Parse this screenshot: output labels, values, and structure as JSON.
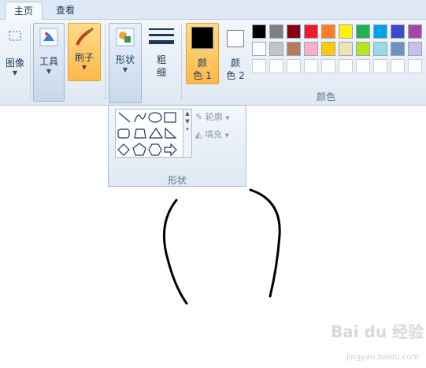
{
  "tabs": [
    {
      "label": "主页",
      "active": true
    },
    {
      "label": "查看",
      "active": false
    }
  ],
  "toolbar": {
    "image": "图像",
    "tools": "工具",
    "brush": "刷子",
    "shapes": "形状",
    "size_line1": "粗",
    "size_line2": "细",
    "color1_line1": "颜",
    "color1_line2": "色 1",
    "color2_line1": "颜",
    "color2_line2": "色 2",
    "colors_group": "颜色"
  },
  "palette": {
    "row1": [
      "#000000",
      "#7f7f7f",
      "#880015",
      "#ed1c24",
      "#ff7f27",
      "#fff200",
      "#22b14c",
      "#00a2e8",
      "#3f48cc",
      "#a349a4"
    ],
    "row2": [
      "#ffffff",
      "#c3c3c3",
      "#b97a57",
      "#ffaec9",
      "#ffc90e",
      "#efe4b0",
      "#b5e61d",
      "#99d9ea",
      "#7092be",
      "#c8bfe7"
    ],
    "row3": [
      "#ffffff",
      "#ffffff",
      "#ffffff",
      "#ffffff",
      "#ffffff",
      "#ffffff",
      "#ffffff",
      "#ffffff",
      "#ffffff",
      "#ffffff"
    ],
    "color1": "#000000",
    "color2": "#ffffff"
  },
  "shapes_popup": {
    "outline": "轮廓",
    "fill": "填充",
    "label": "形状"
  },
  "watermark": {
    "text": "Bai du 经验",
    "url": "jingyan.baidu.com"
  }
}
